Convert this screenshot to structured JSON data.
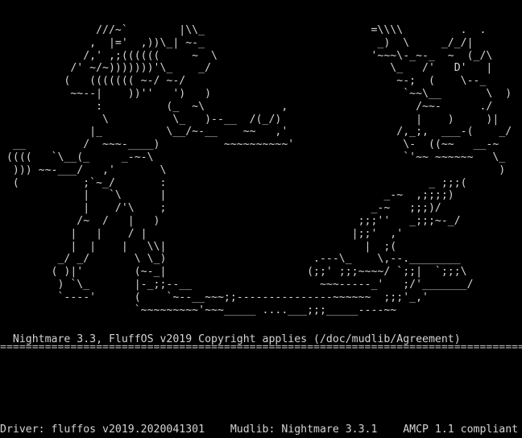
{
  "terminal": {
    "colors": {
      "background": "#000000",
      "foreground": "#d4d4d4"
    },
    "ascii_art": "               ///~`        |\\\\_                          =\\\\\\\\         .  .\n              ,  |='  ,))\\_| ~-_                           _)  \\     _/_/|\n             /,' ,;((((((     ~  \\                        '~~~\\-_~-_  ~  (_/\\\n           /' ~/~)))))))'\\_    _/                            \\_   /'   D'   |\n          (   ((((((( ~-/ ~-/                                 ~-;  (    \\--_\n           ~~--|    ))''   ')   )                              `~~\\__       \\  )\n               :          (_  ~\\            ,                    /~~-      ./\n                \\          \\_   )--__  /(_/)                     |    )     )|\n              |_          \\__/~-__    ~~   ,'                 /,_;,  ___-(    _/    |\n  __         /  ~~~-____)          ~~~~~~~~~~'                 \\-  ((~~   __-~       |\n ((((   `\\__(_     _-~-\\                                       `'~~ ~~~~~~   \\_      |\n  ))) ~~-___/   ,'       \\                                                    )      )\n  (          ;`~_/       :                                         _ ;;;(\n             |   `\\      |                                  _-~  ,;;;;)\n             |    /'\\    ;                                _-~   ;;;)/\n            /~  /   |   )                               ;;;''   _;;;~-_/\n           |   |    / |                                |;;'  ,'\n           |  |    |   \\\\|                               |  ;(\n         _/ _/       \\ \\_)                       .---\\_    \\,--.________\n        ( )|'        (~-_|                      (;;' ;;;~~~~/ `;;|  `;;;\\\n         ) `\\_       |-_;;--__                    ~~~-----_'   ;/'_______/\n         `----'      (    `~--__~~~;;---------------~~~~~~  ;;;'_,'\n                     `~~~~~~~~~'~~~_____ ....___;;;_____----~~",
    "banner": "  Nightmare 3.3, FluffOS v2019 Copyright applies (/doc/mudlib/Agreement)",
    "divider": "========================================================================================",
    "status_line": "Driver: fluffos v2019.2020041301    Mudlib: Nightmare 3.3.1    AMCP 1.1 compliant"
  }
}
